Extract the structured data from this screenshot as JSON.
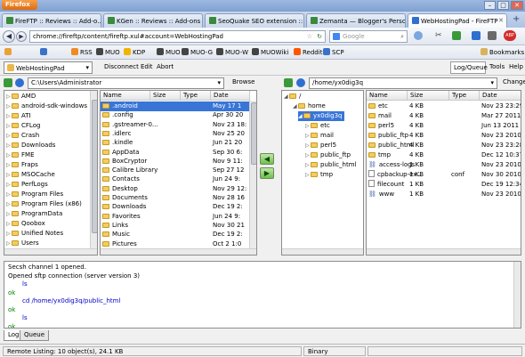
{
  "browser": {
    "app_button": "Firefox",
    "window_buttons": [
      "–",
      "□",
      "✕"
    ],
    "tabs": [
      {
        "label": "FireFTP :: Reviews :: Add-o...",
        "color": "#3b8a3b"
      },
      {
        "label": "KGen :: Reviews :: Add-ons ...",
        "color": "#3b8a3b"
      },
      {
        "label": "SeoQuake SEO extension :: ...",
        "color": "#3b8a3b"
      },
      {
        "label": "Zemanta — Blogger's Perso...",
        "color": "#3b8a3b"
      },
      {
        "label": "WebHostingPad - FireFTP",
        "color": "#2f6fcf"
      }
    ],
    "new_tab": "+",
    "back": "◀",
    "forward": "▶",
    "url": "chrome://fireftp/content/fireftp.xul#account=WebHostingPad",
    "search_placeholder": "Google",
    "bookmarks": [
      {
        "label": "",
        "color": "#e8a23a"
      },
      {
        "label": "",
        "color": "#3a72c9"
      },
      {
        "label": "RSS",
        "color": "#f08a24"
      },
      {
        "label": "MUO",
        "color": "#444"
      },
      {
        "label": "KDP",
        "color": "#f0b400"
      },
      {
        "label": "MUO",
        "color": "#444"
      },
      {
        "label": "MUO-G",
        "color": "#444"
      },
      {
        "label": "MUO-W",
        "color": "#444"
      },
      {
        "label": "MUOWiki",
        "color": "#444"
      },
      {
        "label": "Reddit",
        "color": "#ff5700"
      },
      {
        "label": "SCP",
        "color": "#3a72c9"
      }
    ],
    "bookmarks_menu": "Bookmarks"
  },
  "fireftp": {
    "account": "WebHostingPad",
    "disconnect": "Disconnect",
    "edit": "Edit",
    "abort": "Abort",
    "log_queue": "Log/Queue",
    "tools": "Tools",
    "help": "Help",
    "local_path": "C:\\Users\\Administrator",
    "browse": "Browse",
    "remote_path": "/home/yx0dig3q",
    "change": "Change",
    "headers": {
      "name": "Name",
      "size": "Size",
      "type": "Type",
      "date": "Date"
    }
  },
  "local_tree": [
    "AMD",
    "android-sdk-windows",
    "ATI",
    "CFLog",
    "Crash",
    "Downloads",
    "FME",
    "Fraps",
    "MSOCache",
    "PerfLogs",
    "Program Files",
    "Program Files (x86)",
    "ProgramData",
    "Qoobox",
    "Unified Notes",
    "Users"
  ],
  "local_files": [
    {
      "name": ".android",
      "date": "May 17 1"
    },
    {
      "name": ".config",
      "date": "Apr 30 20"
    },
    {
      "name": ".gstreamer-0...",
      "date": "Nov 23 18:"
    },
    {
      "name": ".idlerc",
      "date": "Nov 25 20"
    },
    {
      "name": ".kindle",
      "date": "Jun 21 20"
    },
    {
      "name": "AppData",
      "date": "Sep 30 6:"
    },
    {
      "name": "BoxCryptor",
      "date": "Nov 9 11:"
    },
    {
      "name": "Calibre Library",
      "date": "Sep 27 12"
    },
    {
      "name": "Contacts",
      "date": "Jun 24 9:"
    },
    {
      "name": "Desktop",
      "date": "Nov 29 12:"
    },
    {
      "name": "Documents",
      "date": "Nov 28 16"
    },
    {
      "name": "Downloads",
      "date": "Dec 19 2:"
    },
    {
      "name": "Favorites",
      "date": "Jun 24 9:"
    },
    {
      "name": "Links",
      "date": "Nov 30 21"
    },
    {
      "name": "Music",
      "date": "Dec 19 2:"
    },
    {
      "name": "Pictures",
      "date": "Oct 2 1:0"
    }
  ],
  "remote_tree": {
    "root": "/",
    "home": "home",
    "user": "yx0dig3q",
    "children": [
      "etc",
      "mail",
      "perl5",
      "public_ftp",
      "public_html",
      "tmp"
    ]
  },
  "remote_files": [
    {
      "name": "etc",
      "size": "4 KB",
      "type": "",
      "date": "Nov 23 23:29",
      "kind": "folder"
    },
    {
      "name": "mail",
      "size": "4 KB",
      "type": "",
      "date": "Mar 27 2011",
      "kind": "folder"
    },
    {
      "name": "perl5",
      "size": "4 KB",
      "type": "",
      "date": "Jun 13 2011",
      "kind": "folder"
    },
    {
      "name": "public_ftp",
      "size": "4 KB",
      "type": "",
      "date": "Nov 23 2010",
      "kind": "folder"
    },
    {
      "name": "public_html",
      "size": "4 KB",
      "type": "",
      "date": "Nov 23 23:28",
      "kind": "folder"
    },
    {
      "name": "tmp",
      "size": "4 KB",
      "type": "",
      "date": "Dec 12 10:37",
      "kind": "folder"
    },
    {
      "name": "access-logs",
      "size": "1 KB",
      "type": "",
      "date": "Nov 23 2010",
      "kind": "link"
    },
    {
      "name": "cpbackup-ex...",
      "size": "1 KB",
      "type": "conf",
      "date": "Nov 30 2010",
      "kind": "file"
    },
    {
      "name": "filecount",
      "size": "1 KB",
      "type": "",
      "date": "Dec 19 12:34",
      "kind": "file"
    },
    {
      "name": "www",
      "size": "1 KB",
      "type": "",
      "date": "Nov 23 2010",
      "kind": "link"
    }
  ],
  "log": [
    {
      "text": "Secsh channel 1 opened.",
      "style": "plain"
    },
    {
      "text": "Opened sftp connection (server version 3)",
      "style": "plain"
    },
    {
      "text": "ls",
      "style": "cmd"
    },
    {
      "text": "ok",
      "style": "ok"
    },
    {
      "text": "cd /home/yx0dig3q/public_html",
      "style": "cmd"
    },
    {
      "text": "ok",
      "style": "ok"
    },
    {
      "text": "ls",
      "style": "cmd"
    },
    {
      "text": "ok",
      "style": "ok"
    }
  ],
  "log_tabs": [
    "Log",
    "Queue"
  ],
  "status": {
    "listing": "Remote Listing: 10 object(s), 24.1 KB",
    "mode": "Binary"
  },
  "colors": {
    "folder": "#f2cd60",
    "accent": "#2f6fcf",
    "log_blue": "#0000c8",
    "log_green": "#008000"
  }
}
